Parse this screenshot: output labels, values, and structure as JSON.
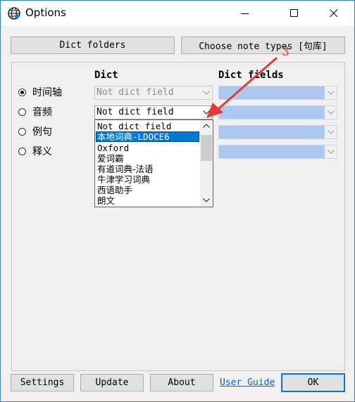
{
  "window": {
    "title": "Options",
    "icon": "globe-icon",
    "controls": [
      "minimize-icon",
      "maximize-icon",
      "close-icon"
    ]
  },
  "top_buttons": {
    "dict_folders": "Dict folders",
    "choose_note_types": "Choose note types [句库]"
  },
  "headers": {
    "dict": "Dict",
    "dict_fields": "Dict fields"
  },
  "rows": [
    {
      "label": "时间轴",
      "checked": true,
      "dict_value": "Not dict field",
      "disabled": true
    },
    {
      "label": "音频",
      "checked": false,
      "dict_value": "Not dict field",
      "disabled": false
    },
    {
      "label": "例句",
      "checked": false,
      "dict_value": "",
      "disabled": false
    },
    {
      "label": "释义",
      "checked": false,
      "dict_value": "",
      "disabled": false
    }
  ],
  "dropdown": {
    "items": [
      "Not dict field",
      "本地词典-LDOCE6",
      "Oxford",
      "爱词霸",
      "有道词典-法语",
      "牛津学习词典",
      "西语助手",
      "朗文"
    ],
    "selected_index": 1
  },
  "annotation": {
    "number": "3",
    "color": "#e53935"
  },
  "bottom_buttons": {
    "settings": "Settings",
    "update": "Update",
    "about": "About",
    "user_guide": "User Guide",
    "ok": "OK"
  },
  "colors": {
    "accent": "#0078d7",
    "field_fill": "#acc8ef"
  }
}
